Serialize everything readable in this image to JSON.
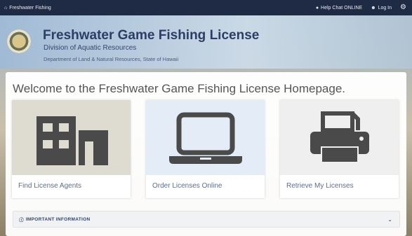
{
  "topbar": {
    "home_label": "Freshwater Fishing",
    "help_chat_label": "Help Chat ONLINE",
    "login_label": "Log In"
  },
  "header": {
    "title": "Freshwater Game Fishing License",
    "subtitle": "Division of Aquatic Resources",
    "department": "Department of Land & Natural Resources, State of Hawaii"
  },
  "main": {
    "welcome": "Welcome to the Freshwater Game Fishing License Homepage.",
    "cards": [
      {
        "label": "Find License Agents",
        "icon": "building-icon"
      },
      {
        "label": "Order Licenses Online",
        "icon": "laptop-icon"
      },
      {
        "label": "Retrieve My Licenses",
        "icon": "printer-icon"
      }
    ],
    "info_label": "IMPORTANT INFORMATION"
  },
  "colors": {
    "topbar_bg": "#1f2a44",
    "title": "#2a3e66",
    "card_label": "#5a6f8c",
    "icon_gray": "#4a4a4a"
  }
}
